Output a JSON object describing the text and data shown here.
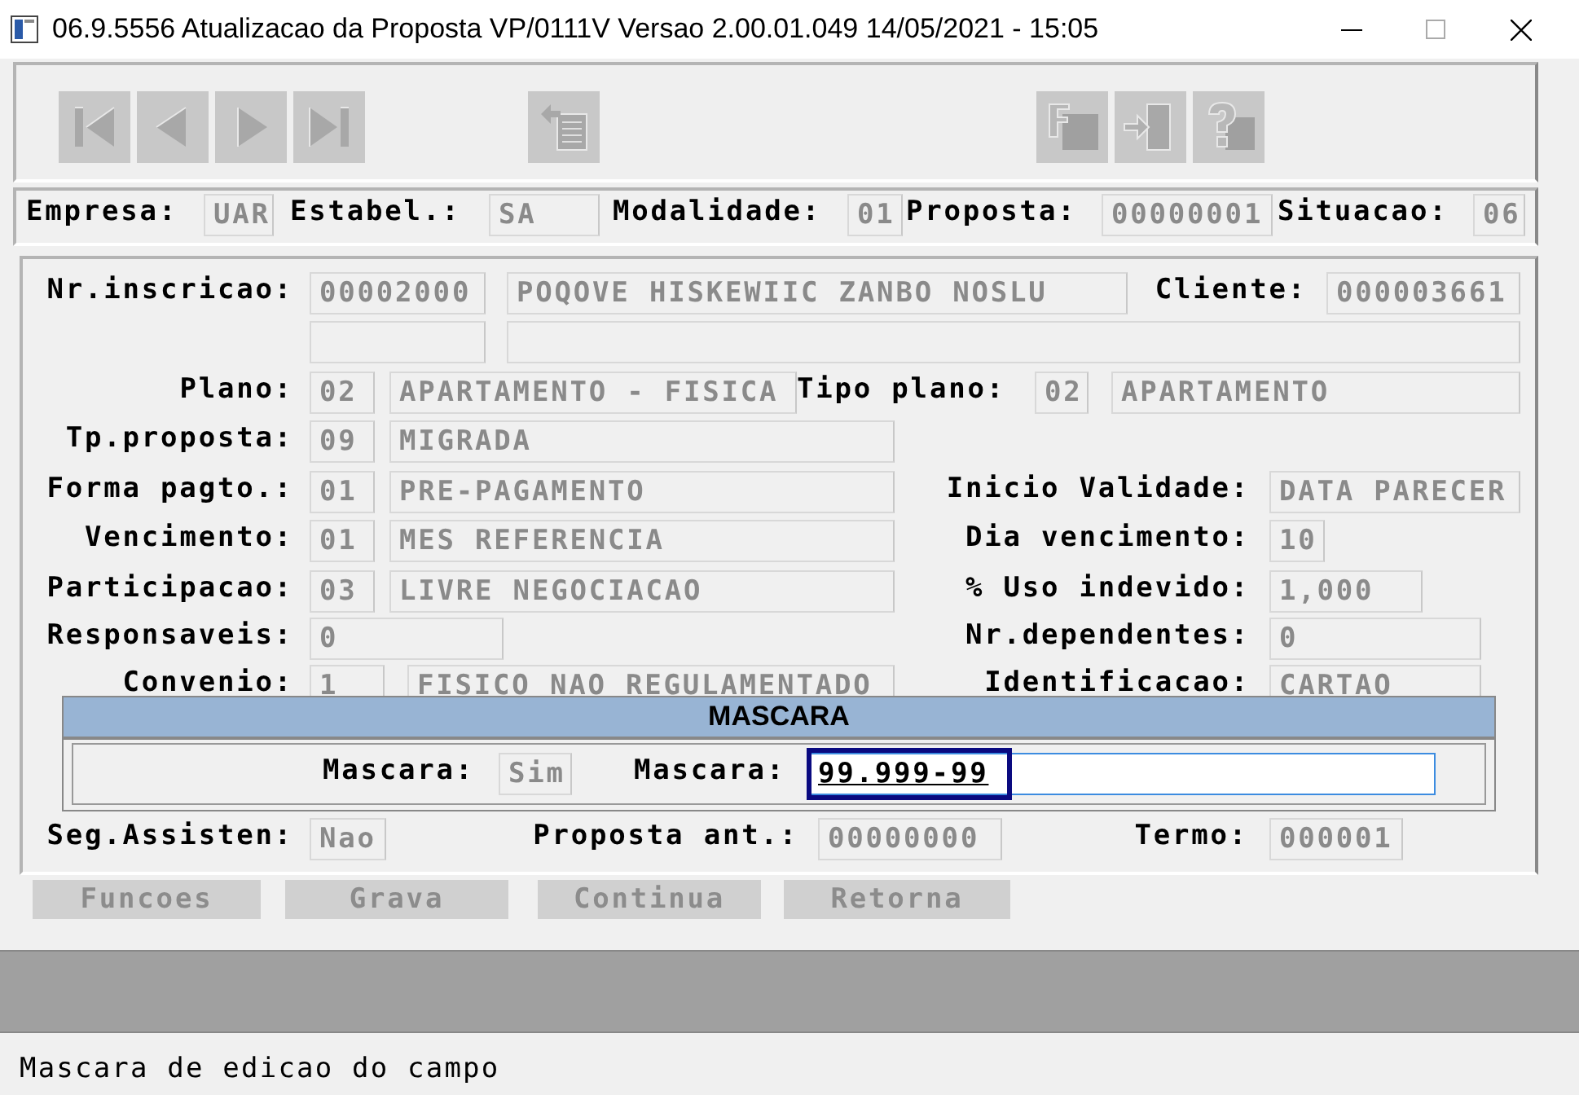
{
  "window": {
    "title": "06.9.5556 Atualizacao da Proposta VP/0111V Versao 2.00.01.049 14/05/2021 - 15:05"
  },
  "toolbar": [
    {
      "kind": "first"
    },
    {
      "kind": "prev"
    },
    {
      "kind": "next"
    },
    {
      "kind": "last"
    },
    {
      "kind": "copy"
    },
    {
      "kind": "filter"
    },
    {
      "kind": "exit"
    },
    {
      "kind": "help"
    }
  ],
  "header": [
    {
      "label": "Empresa:",
      "value": "UAR"
    },
    {
      "label": "Estabel.:",
      "value": "SA"
    },
    {
      "label": "Modalidade:",
      "value": "01"
    },
    {
      "label": "Proposta:",
      "value": "00000001"
    },
    {
      "label": "Situacao:",
      "value": "06"
    }
  ],
  "form": {
    "rows": [
      {
        "items": [
          {
            "kind": "label",
            "text": "Nr.inscricao:"
          },
          {
            "kind": "field",
            "value": "00002000"
          },
          {
            "kind": "field",
            "value": "POQOVE HISKEWIIC ZANBO NOSLU"
          },
          {
            "kind": "label",
            "text": "Cliente:"
          },
          {
            "kind": "field",
            "value": "000003661"
          }
        ]
      },
      {
        "items": [
          {
            "kind": "field"
          },
          {
            "kind": "field"
          }
        ]
      },
      {
        "items": [
          {
            "kind": "label",
            "text": "Plano:"
          },
          {
            "kind": "field",
            "value": "02"
          },
          {
            "kind": "field",
            "value": "APARTAMENTO - FISICA"
          },
          {
            "kind": "label",
            "text": "Tipo plano:"
          },
          {
            "kind": "field",
            "value": "02"
          },
          {
            "kind": "field",
            "value": "APARTAMENTO"
          }
        ]
      },
      {
        "items": [
          {
            "kind": "label",
            "text": "Tp.proposta:"
          },
          {
            "kind": "field",
            "value": "09"
          },
          {
            "kind": "field",
            "value": "MIGRADA"
          }
        ]
      },
      {
        "items": [
          {
            "kind": "label",
            "text": "Forma pagto.:"
          },
          {
            "kind": "field",
            "value": "01"
          },
          {
            "kind": "field",
            "value": "PRE-PAGAMENTO"
          },
          {
            "kind": "label",
            "text": "Inicio Validade:"
          },
          {
            "kind": "field",
            "value": "DATA PARECER"
          }
        ]
      },
      {
        "items": [
          {
            "kind": "label",
            "text": "Vencimento:"
          },
          {
            "kind": "field",
            "value": "01"
          },
          {
            "kind": "field",
            "value": "MES REFERENCIA"
          },
          {
            "kind": "label",
            "text": "Dia vencimento:"
          },
          {
            "kind": "field",
            "value": "10"
          }
        ]
      },
      {
        "items": [
          {
            "kind": "label",
            "text": "Participacao:"
          },
          {
            "kind": "field",
            "value": "03"
          },
          {
            "kind": "field",
            "value": "LIVRE NEGOCIACAO"
          },
          {
            "kind": "label",
            "text": "% Uso indevido:"
          },
          {
            "kind": "field",
            "value": "1,000"
          }
        ]
      },
      {
        "items": [
          {
            "kind": "label",
            "text": "Responsaveis:"
          },
          {
            "kind": "field",
            "value": "0"
          },
          {
            "kind": "label",
            "text": "Nr.dependentes:"
          },
          {
            "kind": "field",
            "value": "0"
          }
        ]
      },
      {
        "items": [
          {
            "kind": "label",
            "text": "Convenio:"
          },
          {
            "kind": "field",
            "value": "1"
          },
          {
            "kind": "field",
            "value": "FISICO NAO REGULAMENTADO"
          },
          {
            "kind": "label",
            "text": "Identificacao:"
          },
          {
            "kind": "field",
            "value": "CARTAO"
          }
        ]
      },
      {
        "items": [
          {
            "kind": "label",
            "text": "Seg.Assisten:"
          },
          {
            "kind": "field",
            "value": "Nao"
          },
          {
            "kind": "label",
            "text": "Proposta ant.:"
          },
          {
            "kind": "field",
            "value": "00000000"
          },
          {
            "kind": "label",
            "text": "Termo:"
          },
          {
            "kind": "field",
            "value": "000001"
          }
        ]
      }
    ]
  },
  "dialog": {
    "title": "MASCARA",
    "fields": [
      {
        "label": "Mascara:",
        "value": "Sim",
        "editable": false,
        "selected": false
      },
      {
        "label": "Mascara:",
        "value": "99.999-99",
        "editable": true,
        "selected": true
      }
    ]
  },
  "buttons": [
    {
      "label": "Funcoes",
      "disabled": true
    },
    {
      "label": "Grava",
      "disabled": true
    },
    {
      "label": "Continua",
      "disabled": true
    },
    {
      "label": "Retorna",
      "disabled": true
    }
  ],
  "status_bar": "Mascara de edicao do campo"
}
